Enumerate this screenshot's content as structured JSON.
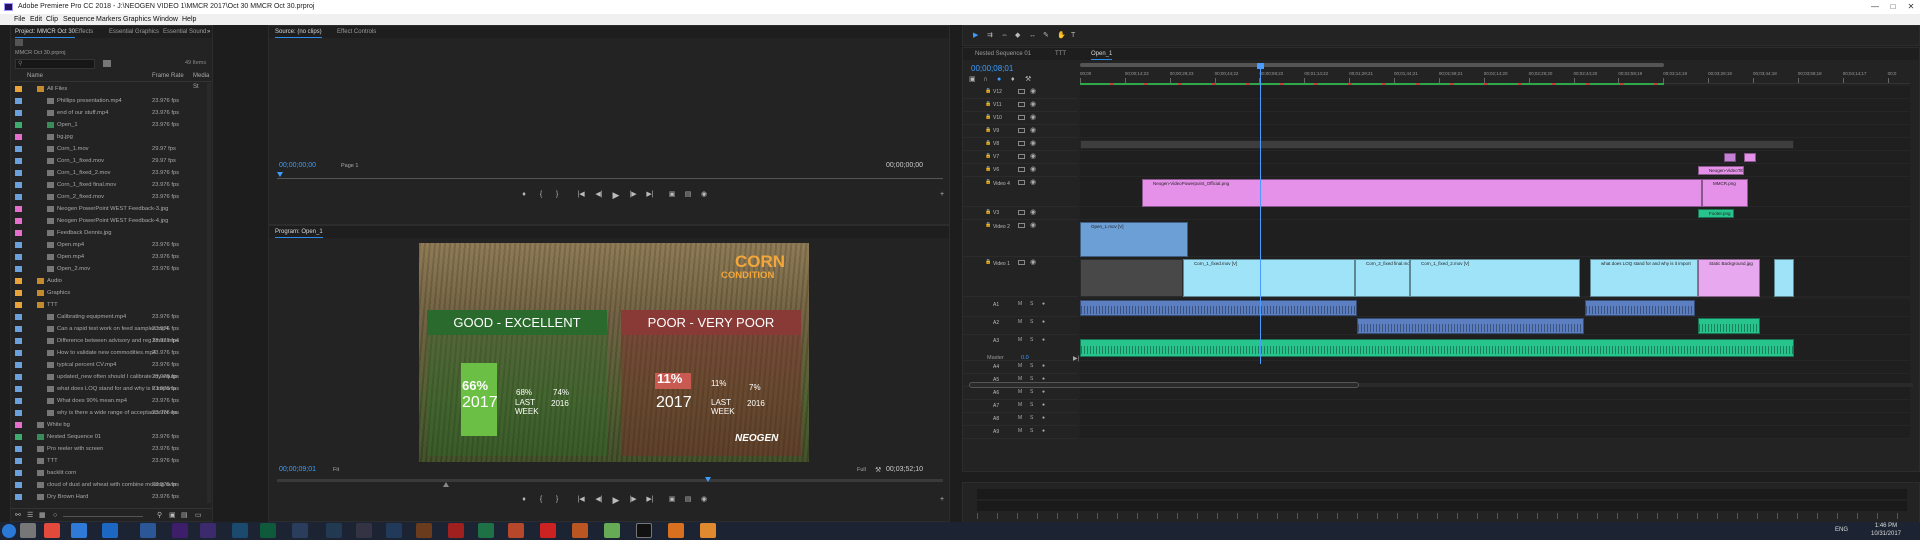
{
  "window": {
    "title": "Adobe Premiere Pro CC 2018 - J:\\NEOGEN VIDEO 1\\MMCR 2017\\Oct 30 MMCR Oct 30.prproj"
  },
  "menu": [
    "File",
    "Edit",
    "Clip",
    "Sequence",
    "Markers",
    "Graphics",
    "Window",
    "Help"
  ],
  "project_panel": {
    "tabs": [
      "Project: MMCR Oct 30",
      "Effects",
      "Essential Graphics",
      "Essential Sound"
    ],
    "bin_name": "MMCR Oct 30.prproj",
    "item_count": "49 Items",
    "columns": {
      "name": "Name",
      "frame_rate": "Frame Rate",
      "media_start": "Media St"
    },
    "items": [
      {
        "name": "All Files",
        "rate": "",
        "color": "#e8a33b",
        "indent": 1,
        "type": "folder"
      },
      {
        "name": "Phillips presentation.mp4",
        "rate": "23.976 fps",
        "color": "#6ca0dc",
        "indent": 2,
        "type": "file"
      },
      {
        "name": "end of our stuff.mp4",
        "rate": "23.976 fps",
        "color": "#6ca0dc",
        "indent": 2,
        "type": "file"
      },
      {
        "name": "Open_1",
        "rate": "23.976 fps",
        "color": "#3dac6f",
        "indent": 2,
        "type": "seq"
      },
      {
        "name": "bg.jpg",
        "rate": "",
        "color": "#e66ecd",
        "indent": 2,
        "type": "file"
      },
      {
        "name": "Corn_1.mov",
        "rate": "29.97 fps",
        "color": "#6ca0dc",
        "indent": 2,
        "type": "file"
      },
      {
        "name": "Corn_1_fixed.mov",
        "rate": "29.97 fps",
        "color": "#6ca0dc",
        "indent": 2,
        "type": "file"
      },
      {
        "name": "Corn_1_fixed_2.mov",
        "rate": "23.976 fps",
        "color": "#6ca0dc",
        "indent": 2,
        "type": "file"
      },
      {
        "name": "Corn_1_fixed final.mov",
        "rate": "23.976 fps",
        "color": "#6ca0dc",
        "indent": 2,
        "type": "file"
      },
      {
        "name": "Corn_2_fixed.mov",
        "rate": "23.976 fps",
        "color": "#6ca0dc",
        "indent": 2,
        "type": "file"
      },
      {
        "name": "Neogen PowerPoint WEST Feedback-3.jpg",
        "rate": "",
        "color": "#e66ecd",
        "indent": 2,
        "type": "file"
      },
      {
        "name": "Neogen PowerPoint WEST Feedback-4.jpg",
        "rate": "",
        "color": "#e66ecd",
        "indent": 2,
        "type": "file"
      },
      {
        "name": "Feedback Dennis.jpg",
        "rate": "",
        "color": "#e66ecd",
        "indent": 2,
        "type": "file"
      },
      {
        "name": "Open.mp4",
        "rate": "23.976 fps",
        "color": "#6ca0dc",
        "indent": 2,
        "type": "file"
      },
      {
        "name": "Open.mp4",
        "rate": "23.976 fps",
        "color": "#6ca0dc",
        "indent": 2,
        "type": "file"
      },
      {
        "name": "Open_2.mov",
        "rate": "23.976 fps",
        "color": "#6ca0dc",
        "indent": 2,
        "type": "file"
      },
      {
        "name": "Audio",
        "rate": "",
        "color": "#e8a33b",
        "indent": 1,
        "type": "folder"
      },
      {
        "name": "Graphics",
        "rate": "",
        "color": "#e8a33b",
        "indent": 1,
        "type": "folder"
      },
      {
        "name": "TTT",
        "rate": "",
        "color": "#e8a33b",
        "indent": 1,
        "type": "folder"
      },
      {
        "name": "Calibrating equipment.mp4",
        "rate": "23.976 fps",
        "color": "#6ca0dc",
        "indent": 2,
        "type": "file"
      },
      {
        "name": "Can a rapid test work on feed samples.mp4",
        "rate": "23.976 fps",
        "color": "#6ca0dc",
        "indent": 2,
        "type": "file"
      },
      {
        "name": "Difference between advisory and reg limits.mp4",
        "rate": "23.976 fps",
        "color": "#6ca0dc",
        "indent": 2,
        "type": "file"
      },
      {
        "name": "How to validate new commodities.mp4",
        "rate": "23.976 fps",
        "color": "#6ca0dc",
        "indent": 2,
        "type": "file"
      },
      {
        "name": "typical percent CV.mp4",
        "rate": "23.976 fps",
        "color": "#6ca0dc",
        "indent": 2,
        "type": "file"
      },
      {
        "name": "updated_new often should I calibrate my equip",
        "rate": "23.976 fps",
        "color": "#6ca0dc",
        "indent": 2,
        "type": "file"
      },
      {
        "name": "what does LOQ stand for and why is it importa",
        "rate": "23.976 fps",
        "color": "#6ca0dc",
        "indent": 2,
        "type": "file"
      },
      {
        "name": "What does 90% mean.mp4",
        "rate": "23.976 fps",
        "color": "#6ca0dc",
        "indent": 2,
        "type": "file"
      },
      {
        "name": "why is there a wide range of acceptance for ea",
        "rate": "23.976 fps",
        "color": "#6ca0dc",
        "indent": 2,
        "type": "file"
      },
      {
        "name": "White bg",
        "rate": "",
        "color": "#e66ecd",
        "indent": 1,
        "type": "file"
      },
      {
        "name": "Nested Sequence 01",
        "rate": "23.976 fps",
        "color": "#3dac6f",
        "indent": 1,
        "type": "seq"
      },
      {
        "name": "Pro reeler with screen",
        "rate": "23.976 fps",
        "color": "#6ca0dc",
        "indent": 1,
        "type": "file"
      },
      {
        "name": "TTT",
        "rate": "23.976 fps",
        "color": "#6ca0dc",
        "indent": 1,
        "type": "file"
      },
      {
        "name": "backlit corn",
        "rate": "",
        "color": "#6ca0dc",
        "indent": 1,
        "type": "file"
      },
      {
        "name": "cloud of dust and wheat with combine moving over",
        "rate": "23.976 fps",
        "color": "#6ca0dc",
        "indent": 1,
        "type": "file"
      },
      {
        "name": "Dry Brown Hard",
        "rate": "23.976 fps",
        "color": "#6ca0dc",
        "indent": 1,
        "type": "file"
      }
    ]
  },
  "source_monitor": {
    "tabs": [
      "Source: (no clips)",
      "Effect Controls"
    ],
    "timecode_left": "00;00;00;00",
    "page": "Page 1",
    "timecode_right": "00;00;00;00"
  },
  "program_monitor": {
    "tab": "Program: Open_1",
    "timecode_left": "00;00;09;01",
    "fit": "Fit",
    "quality": "Full",
    "timecode_right": "00;03;52;10",
    "frame": {
      "title_line1": "CORN",
      "title_line2": "CONDITION",
      "left_header": "GOOD - EXCELLENT",
      "right_header": "POOR - VERY POOR",
      "good_big_pct": "66%",
      "good_year": "2017",
      "good_mid_pct": "68%",
      "good_mid_label": "LAST WEEK",
      "good_small_pct": "74%",
      "good_small_year": "2016",
      "poor_big_pct": "11%",
      "poor_year": "2017",
      "poor_mid_pct": "11%",
      "poor_mid_label": "LAST WEEK",
      "poor_small_pct": "7%",
      "poor_small_year": "2016",
      "logo": "NEOGEN",
      "good_bar_fraction": 0.66,
      "poor_bar_fraction": 0.11
    }
  },
  "timeline": {
    "tabs": [
      "Nested Sequence 01",
      "TTT",
      "Open_1"
    ],
    "timecode": "00;00;08;01",
    "ruler_labels": [
      "00;00",
      "00;00;14;23",
      "00;00;29;23",
      "00;00;44;22",
      "00;00;59;22",
      "00;01;14;22",
      "00;01;29;21",
      "00;01;44;21",
      "00;01;59;21",
      "00;02;14;20",
      "00;02;29;20",
      "00;02;44;20",
      "00;02;59;19",
      "00;03;14;19",
      "00;03;29;19",
      "00;03;44;18",
      "00;03;59;18",
      "00;04;14;17",
      "00;0"
    ],
    "video_tracks": [
      "V12",
      "V11",
      "V10",
      "V9",
      "V8",
      "V7",
      "V6",
      "Video 4",
      "V3",
      "Video 2",
      "Video 1"
    ],
    "audio_tracks": [
      "A1",
      "A2",
      "A3",
      "A4",
      "A5",
      "A6",
      "A7",
      "A8",
      "A9"
    ],
    "master_label": "Master",
    "master_value": "0.0",
    "clips": {
      "v4_main": "Neogen-VideoPowerpoint_Official.png",
      "v4_right": "MMCR.png",
      "v6": "Neogen-VideoTitle.png",
      "v3": "Footer.png",
      "v2": "Open_1.mov [V]",
      "v1": [
        "Corn_1_fixed.mov [V]",
        "Corn_2_fixed final.mov [V]",
        "Corn_1_fixed_2.mov [V]",
        "what does LOQ stand for and why is it import",
        "Static Background.jpg"
      ]
    }
  },
  "taskbar": {
    "time": "1:46 PM",
    "date": "10/31/2017",
    "lang": "ENG"
  },
  "colors": {
    "accent": "#2d8ceb",
    "timecode": "#3b9dff",
    "playhead": "#4a9dff",
    "video_clip": "#9ee3f7",
    "title_clip": "#e691e9",
    "seq_clip": "#6c9fd6",
    "audio_clip": "#5b7fc0",
    "audio_green": "#27c48d"
  }
}
